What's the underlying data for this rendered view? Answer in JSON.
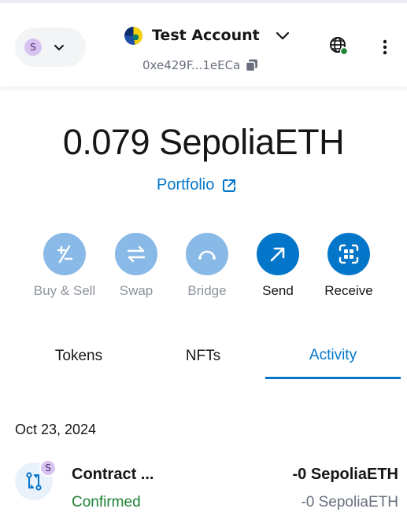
{
  "header": {
    "network_avatar_letter": "S",
    "account_name": "Test Account",
    "account_address": "0xe429F...1eECa",
    "icons": {
      "network_chevron": "chevron-down-icon",
      "account_chevron": "chevron-down-icon",
      "copy": "copy-icon",
      "connections": "globe-icon",
      "menu": "kebab-menu-icon"
    }
  },
  "balance": {
    "amount": "0.079",
    "currency": "SepoliaETH",
    "display": "0.079 SepoliaETH"
  },
  "portfolio": {
    "label": "Portfolio",
    "icon": "external-link-icon"
  },
  "actions": [
    {
      "label": "Buy & Sell",
      "icon": "buy-sell-icon",
      "enabled": false
    },
    {
      "label": "Swap",
      "icon": "swap-icon",
      "enabled": false
    },
    {
      "label": "Bridge",
      "icon": "bridge-icon",
      "enabled": false
    },
    {
      "label": "Send",
      "icon": "send-arrow-icon",
      "enabled": true
    },
    {
      "label": "Receive",
      "icon": "qr-scan-icon",
      "enabled": true
    }
  ],
  "tabs": [
    {
      "label": "Tokens",
      "active": false
    },
    {
      "label": "NFTs",
      "active": false
    },
    {
      "label": "Activity",
      "active": true
    }
  ],
  "activity": {
    "groups": [
      {
        "date": "Oct 23, 2024",
        "items": [
          {
            "title": "Contract ...",
            "status": "Confirmed",
            "amount": "-0 SepoliaETH",
            "amount_secondary": "-0 SepoliaETH",
            "badge_letter": "S",
            "icon": "contract-interaction-icon"
          }
        ]
      }
    ]
  },
  "colors": {
    "primary": "#0376c9",
    "primary_disabled": "#89b9e6",
    "success": "#1c8234",
    "text_muted": "#686e7d",
    "avatar_bg": "#d8c2ef"
  }
}
